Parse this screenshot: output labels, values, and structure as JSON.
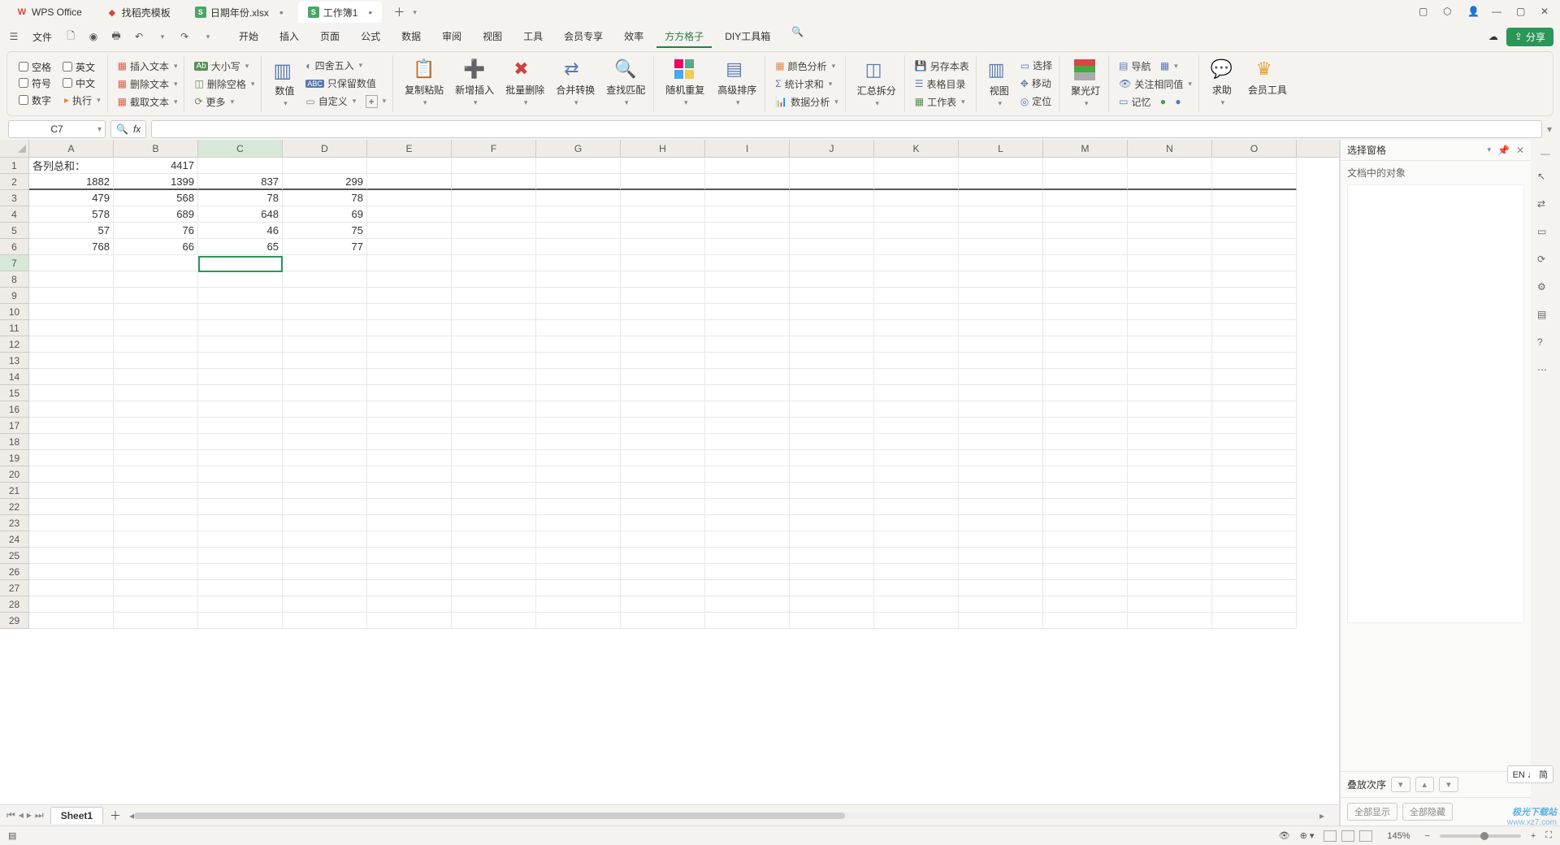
{
  "title_bar": {
    "tabs": [
      {
        "icon": "wps",
        "label": "WPS Office"
      },
      {
        "icon": "doc",
        "label": "找稻壳模板"
      },
      {
        "icon": "xls",
        "label": "日期年份.xlsx",
        "dirty": true
      },
      {
        "icon": "xls",
        "label": "工作簿1",
        "dirty": true,
        "active": true
      }
    ]
  },
  "menu": {
    "file": "文件",
    "tabs": [
      "开始",
      "插入",
      "页面",
      "公式",
      "数据",
      "审阅",
      "视图",
      "工具",
      "会员专享",
      "效率",
      "方方格子",
      "DIY工具箱"
    ],
    "active_index": 10,
    "share": "分享"
  },
  "ribbon": {
    "checks": [
      "空格",
      "英文",
      "符号",
      "中文",
      "数字"
    ],
    "exec": "执行",
    "text_group": [
      "插入文本",
      "删除文本",
      "截取文本"
    ],
    "case_group": [
      "大小写",
      "删除空格",
      "更多"
    ],
    "value_label": "数值",
    "value_group": [
      "四舍五入",
      "只保留数值",
      "自定义"
    ],
    "main_ops": [
      "复制粘贴",
      "新增插入",
      "批量删除",
      "合并转换",
      "查找匹配"
    ],
    "random": "随机重复",
    "advanced_sort": "高级排序",
    "analysis": [
      "颜色分析",
      "统计求和",
      "数据分析"
    ],
    "summary": "汇总拆分",
    "table_group": [
      "另存本表",
      "表格目录",
      "工作表"
    ],
    "view": "视图",
    "view_group": [
      "选择",
      "移动",
      "定位"
    ],
    "spotlight": "聚光灯",
    "nav": "导航",
    "watch": [
      "关注相同值",
      "记忆"
    ],
    "help": "求助",
    "member_tools": "会员工具"
  },
  "formula": {
    "name_box": "C7",
    "fx": "fx"
  },
  "sheet": {
    "columns": [
      "A",
      "B",
      "C",
      "D",
      "E",
      "F",
      "G",
      "H",
      "I",
      "J",
      "K",
      "L",
      "M",
      "N",
      "O"
    ],
    "selected_col": "C",
    "selected_row": 7,
    "rows_visible": 29,
    "data": [
      [
        "各列总和：",
        "4417",
        "",
        "",
        "",
        "",
        "",
        "",
        "",
        "",
        "",
        "",
        "",
        "",
        ""
      ],
      [
        "1882",
        "1399",
        "837",
        "299",
        "",
        "",
        "",
        "",
        "",
        "",
        "",
        "",
        "",
        "",
        ""
      ],
      [
        "479",
        "568",
        "78",
        "78",
        "",
        "",
        "",
        "",
        "",
        "",
        "",
        "",
        "",
        "",
        ""
      ],
      [
        "578",
        "689",
        "648",
        "69",
        "",
        "",
        "",
        "",
        "",
        "",
        "",
        "",
        "",
        "",
        ""
      ],
      [
        "57",
        "76",
        "46",
        "75",
        "",
        "",
        "",
        "",
        "",
        "",
        "",
        "",
        "",
        "",
        ""
      ],
      [
        "768",
        "66",
        "65",
        "77",
        "",
        "",
        "",
        "",
        "",
        "",
        "",
        "",
        "",
        "",
        ""
      ]
    ],
    "sheet_name": "Sheet1"
  },
  "side_panel": {
    "title": "选择窗格",
    "subtitle": "文档中的对象",
    "order": "叠放次序",
    "show_all": "全部显示",
    "hide_all": "全部隐藏"
  },
  "ime": "EN ♩ 简",
  "status": {
    "zoom": "145%"
  },
  "watermark": {
    "top": "极光下载站",
    "bot": "www.xz7.com"
  },
  "chart_data": {
    "type": "table",
    "title": "各列总和：",
    "totals_sum": 4417,
    "columns": [
      "A",
      "B",
      "C",
      "D"
    ],
    "column_sums": [
      1882,
      1399,
      837,
      299
    ],
    "series": [
      {
        "name": "A",
        "values": [
          479,
          578,
          57,
          768
        ]
      },
      {
        "name": "B",
        "values": [
          568,
          689,
          76,
          66
        ]
      },
      {
        "name": "C",
        "values": [
          78,
          648,
          46,
          65
        ]
      },
      {
        "name": "D",
        "values": [
          78,
          69,
          75,
          77
        ]
      }
    ]
  }
}
